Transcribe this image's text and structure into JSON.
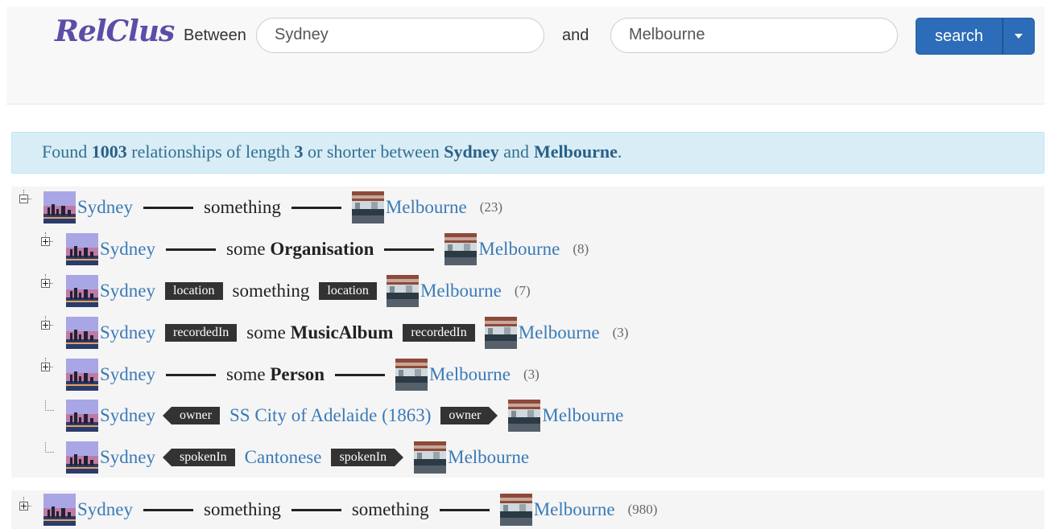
{
  "header": {
    "logo": "RelClus",
    "between_label": "Between",
    "from_value": "Sydney",
    "and_label": "and",
    "to_value": "Melbourne",
    "search_label": "search"
  },
  "alert": {
    "prefix": "Found",
    "count": "1003",
    "middle": "relationships of length",
    "length": "3",
    "middle2": "or shorter between",
    "from": "Sydney",
    "and": "and",
    "to": "Melbourne",
    "end": "."
  },
  "tree": {
    "root1": {
      "from": "Sydney",
      "mid": "something",
      "to": "Melbourne",
      "count": "(23)"
    },
    "children": [
      {
        "from": "Sydney",
        "mid_pre": "some",
        "mid_bold": "Organisation",
        "to": "Melbourne",
        "count": "(8)"
      },
      {
        "from": "Sydney",
        "tag1": "location",
        "mid": "something",
        "tag2": "location",
        "to": "Melbourne",
        "count": "(7)"
      },
      {
        "from": "Sydney",
        "tag1": "recordedIn",
        "mid_pre": "some",
        "mid_bold": "MusicAlbum",
        "tag2": "recordedIn",
        "to": "Melbourne",
        "count": "(3)"
      },
      {
        "from": "Sydney",
        "mid_pre": "some",
        "mid_bold": "Person",
        "to": "Melbourne",
        "count": "(3)"
      },
      {
        "from": "Sydney",
        "tag1": "owner",
        "mid": "SS City of Adelaide (1863)",
        "tag2": "owner",
        "to": "Melbourne"
      },
      {
        "from": "Sydney",
        "tag1": "spokenIn",
        "mid": "Cantonese",
        "tag2": "spokenIn",
        "to": "Melbourne"
      }
    ],
    "root2": {
      "from": "Sydney",
      "mid1": "something",
      "mid2": "something",
      "to": "Melbourne",
      "count": "(980)"
    }
  },
  "colors": {
    "link": "#3a7ab8",
    "button": "#2d6cb8",
    "alert_bg": "#d9edf7",
    "tag_bg": "#333333"
  }
}
